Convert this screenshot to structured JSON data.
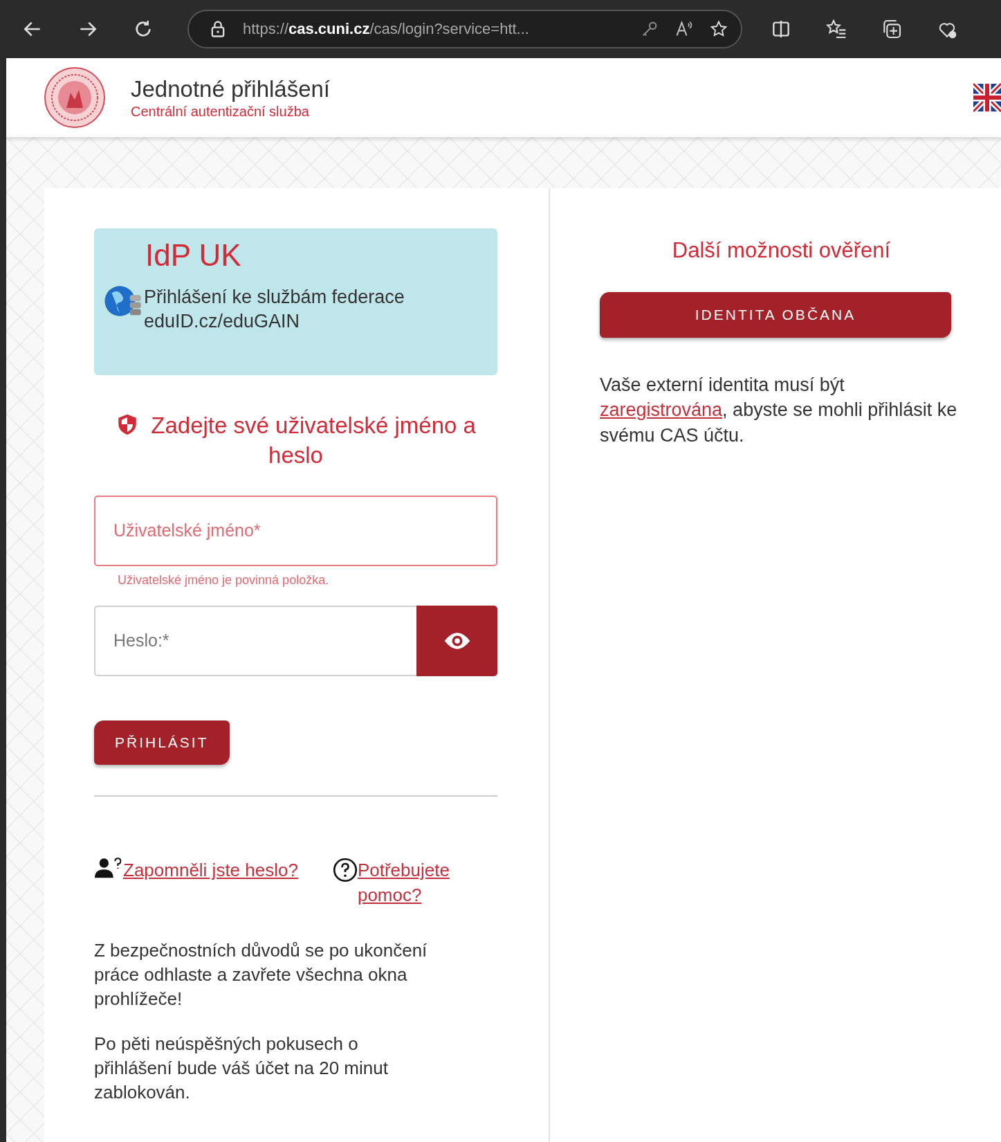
{
  "browser": {
    "url": "https://**cas.cuni.cz**/cas/login?service=htt..."
  },
  "header": {
    "title": "Jednotné přihlášení",
    "subtitle": "Centrální autentizační služba"
  },
  "idp": {
    "title": "IdP UK",
    "text": "Přihlášení ke službám federace eduID.cz/eduGAIN"
  },
  "login": {
    "heading": "Zadejte své uživatelské jméno a heslo",
    "username": {
      "placeholder": "Uživatelské jméno*",
      "invalid": true,
      "error": "Uživatelské jméno je povinná položka."
    },
    "password": {
      "placeholder": "Heslo:*"
    },
    "submit": "PŘIHLÁSIT"
  },
  "help_links": [
    {
      "kind": "user",
      "label": "Zapomněli jste heslo?"
    },
    {
      "kind": "help",
      "label": "Potřebujete pomoc?"
    }
  ],
  "notes": [
    "Z bezpečnostních důvodů se po ukončení práce odhlaste a zavřete všechna okna prohlížeče!",
    "Po pěti neúspěšných pokusech o přihlášení bude váš účet na 20 minut zablokován."
  ],
  "alternatives": {
    "heading": "Další možnosti ověření",
    "button": "IDENTITA OBČANA",
    "note_before": "Vaše externí identita musí být",
    "note_link": "zaregistrována",
    "note_after": ", abyste se mohli přihlásit ke svému CAS účtu."
  }
}
